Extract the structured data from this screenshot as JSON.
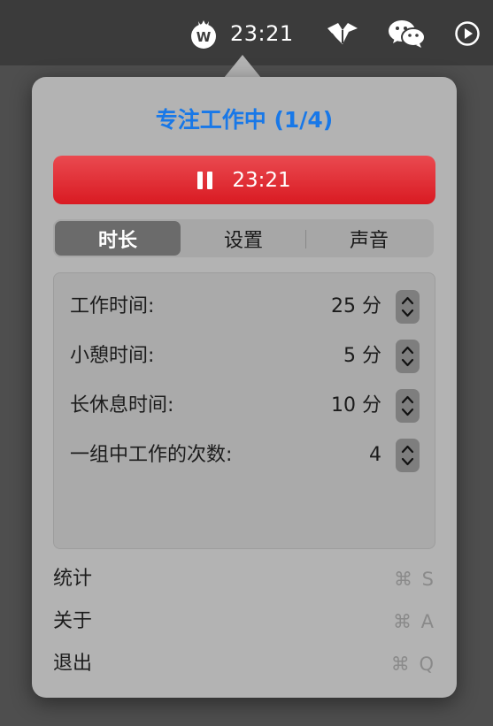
{
  "menubar": {
    "time": "23:21",
    "tomato_icon_letter": "W"
  },
  "popover": {
    "title": "专注工作中 (1/4)",
    "timer_label": "23:21",
    "tabs": [
      {
        "label": "时长",
        "active": true
      },
      {
        "label": "设置",
        "active": false
      },
      {
        "label": "声音",
        "active": false
      }
    ],
    "settings": [
      {
        "label": "工作时间:",
        "value": "25 分"
      },
      {
        "label": "小憩时间:",
        "value": "5 分"
      },
      {
        "label": "长休息时间:",
        "value": "10 分"
      },
      {
        "label": "一组中工作的次数:",
        "value": "4"
      }
    ],
    "menu": [
      {
        "label": "统计",
        "shortcut": "⌘ S"
      },
      {
        "label": "关于",
        "shortcut": "⌘ A"
      },
      {
        "label": "退出",
        "shortcut": "⌘ Q"
      }
    ]
  },
  "colors": {
    "accent": "#1878e8",
    "timer_red": "#e02a30",
    "popover_bg": "#b3b3b3"
  }
}
